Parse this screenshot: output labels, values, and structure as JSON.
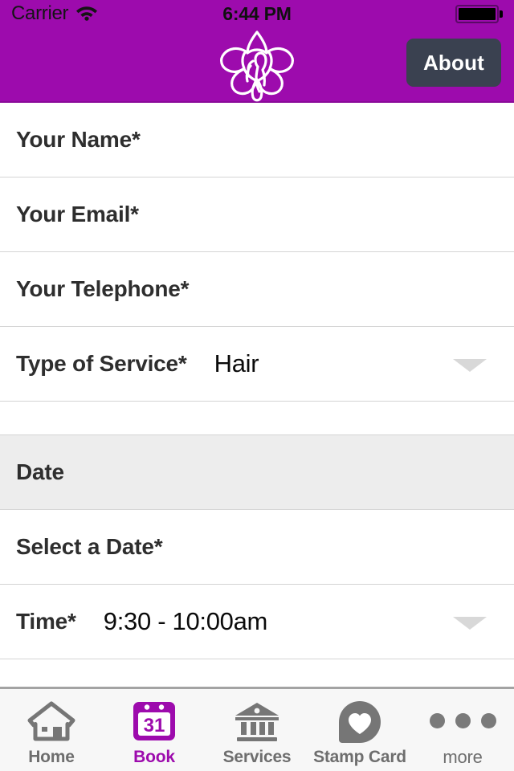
{
  "status_bar": {
    "carrier": "Carrier",
    "wifi_icon": "wifi-icon",
    "time": "6:44 PM",
    "battery_icon": "battery-full-icon"
  },
  "header": {
    "logo_icon": "orchid-flower-logo",
    "about_label": "About",
    "background_color": "#9d0bad",
    "about_button_color": "#3a4150"
  },
  "form": {
    "fields": [
      {
        "label": "Your Name*",
        "value": "",
        "has_caret": false
      },
      {
        "label": "Your Email*",
        "value": "",
        "has_caret": false
      },
      {
        "label": "Your Telephone*",
        "value": "",
        "has_caret": false
      },
      {
        "label": "Type of Service*",
        "value": "Hair",
        "has_caret": true
      }
    ],
    "date_section": {
      "header": "Date",
      "fields": [
        {
          "label": "Select a Date*",
          "value": "",
          "has_caret": false
        },
        {
          "label": "Time*",
          "value": "9:30 - 10:00am",
          "has_caret": true
        }
      ]
    }
  },
  "tabbar": {
    "items": [
      {
        "label": "Home",
        "icon": "home-icon",
        "active": false
      },
      {
        "label": "Book",
        "icon": "calendar-31-icon",
        "active": true
      },
      {
        "label": "Services",
        "icon": "bank-columns-icon",
        "active": false
      },
      {
        "label": "Stamp Card",
        "icon": "pin-heart-icon",
        "active": false
      },
      {
        "label": "more",
        "icon": "ellipsis-icon",
        "active": false
      }
    ],
    "active_color": "#9d0bad",
    "inactive_color": "#6e6e6e"
  }
}
